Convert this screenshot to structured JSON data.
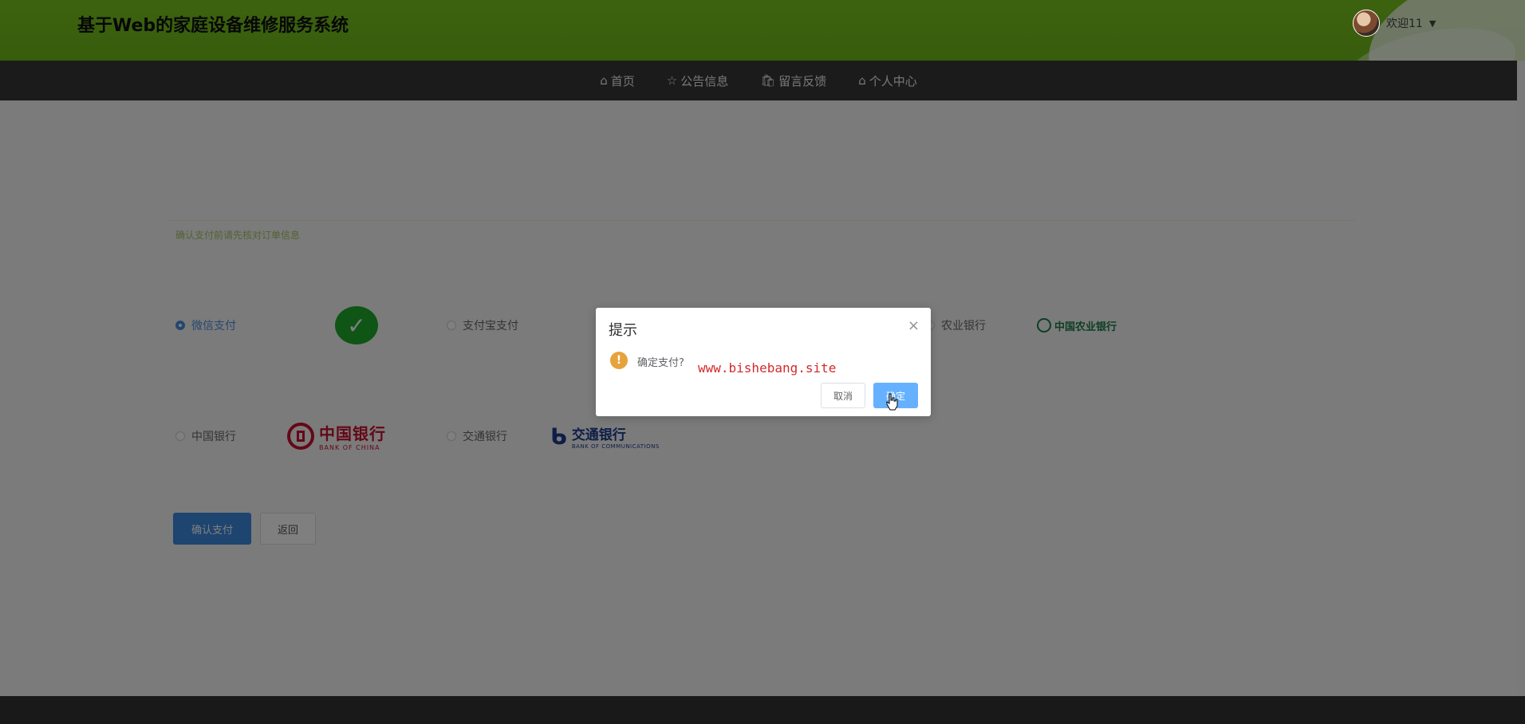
{
  "header": {
    "site_title": "基于Web的家庭设备维修服务系统",
    "welcome": "欢迎11",
    "caret": "▼"
  },
  "nav": {
    "items": [
      {
        "label": "首页",
        "icon": "⌂"
      },
      {
        "label": "公告信息",
        "icon": "☆"
      },
      {
        "label": "留言反馈",
        "icon": "🛍"
      },
      {
        "label": "个人中心",
        "icon": "⌂"
      }
    ]
  },
  "payment": {
    "hint": "确认支付前请先核对订单信息",
    "options": [
      {
        "label": "微信支付",
        "selected": true
      },
      {
        "label": "支付宝支付"
      },
      {
        "label": "农业银行"
      },
      {
        "label": "中国银行"
      },
      {
        "label": "交通银行"
      }
    ],
    "logos": {
      "abc": "中国农业银行",
      "boc_cn": "中国银行",
      "boc_en": "BANK OF CHINA",
      "bocom_cn": "交通银行",
      "bocom_en": "BANK OF COMMUNICATIONS",
      "partial_text": "行"
    },
    "confirm_button": "确认支付",
    "back_button": "返回"
  },
  "dialog": {
    "title": "提示",
    "close": "×",
    "icon": "!",
    "message": "确定支付?",
    "watermark": "www.bishebang.site",
    "cancel": "取消",
    "ok": "确定"
  },
  "colors": {
    "header_green": "#7ac51f",
    "nav_dark": "#373737",
    "primary_blue": "#3c8be0",
    "warning": "#e6a23c"
  }
}
